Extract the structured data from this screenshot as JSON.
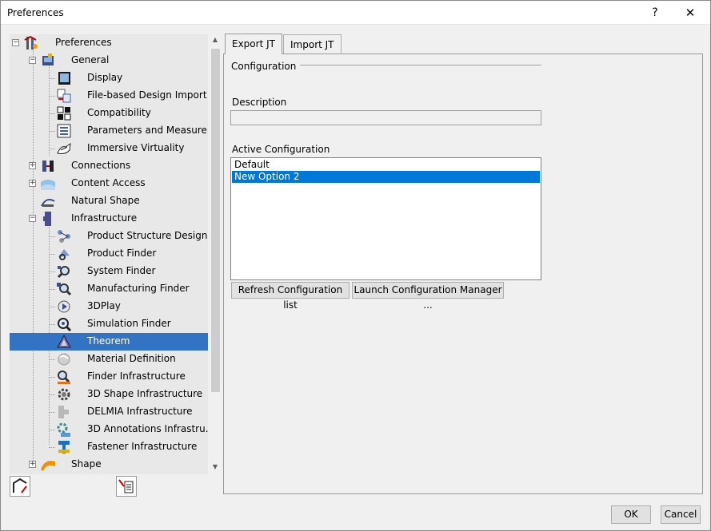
{
  "window": {
    "title": "Preferences",
    "help_label": "?",
    "close_label": "✕"
  },
  "tree": {
    "items": [
      {
        "label": "Preferences",
        "icon": "preferences-icon"
      },
      {
        "label": "General",
        "icon": "general-icon"
      },
      {
        "label": "Display",
        "icon": "display-icon"
      },
      {
        "label": "File-based Design Import",
        "icon": "file-import-icon"
      },
      {
        "label": "Compatibility",
        "icon": "compatibility-icon"
      },
      {
        "label": "Parameters and Measure",
        "icon": "parameters-icon"
      },
      {
        "label": "Immersive Virtuality",
        "icon": "immersive-icon"
      },
      {
        "label": "Connections",
        "icon": "connections-icon"
      },
      {
        "label": "Content Access",
        "icon": "content-access-icon"
      },
      {
        "label": "Natural Shape",
        "icon": "natural-shape-icon"
      },
      {
        "label": "Infrastructure",
        "icon": "infrastructure-icon"
      },
      {
        "label": "Product Structure Design",
        "icon": "product-structure-icon"
      },
      {
        "label": "Product Finder",
        "icon": "product-finder-icon"
      },
      {
        "label": "System Finder",
        "icon": "system-finder-icon"
      },
      {
        "label": "Manufacturing Finder",
        "icon": "manufacturing-finder-icon"
      },
      {
        "label": "3DPlay",
        "icon": "3dplay-icon"
      },
      {
        "label": "Simulation Finder",
        "icon": "simulation-finder-icon"
      },
      {
        "label": "Theorem",
        "icon": "theorem-icon",
        "selected": true
      },
      {
        "label": "Material Definition",
        "icon": "material-icon"
      },
      {
        "label": "Finder Infrastructure",
        "icon": "finder-infra-icon"
      },
      {
        "label": "3D Shape Infrastructure",
        "icon": "gear-icon"
      },
      {
        "label": "DELMIA Infrastructure",
        "icon": "delmia-icon"
      },
      {
        "label": "3D Annotations Infrastru...",
        "icon": "annotations-icon"
      },
      {
        "label": "Fastener Infrastructure",
        "icon": "fastener-icon"
      },
      {
        "label": "Shape",
        "icon": "shape-icon"
      }
    ]
  },
  "tabs": [
    {
      "label": "Export JT",
      "active": true
    },
    {
      "label": "Import JT",
      "active": false
    }
  ],
  "export_jt": {
    "configuration_label": "Configuration",
    "description_label": "Description",
    "description_value": "",
    "active_configuration_label": "Active Configuration",
    "configurations": [
      "Default",
      "New Option 2"
    ],
    "selected_configuration": "New Option 2",
    "refresh_button": "Refresh Configuration list",
    "launch_button": "Launch Configuration Manager ..."
  },
  "footer": {
    "ok_label": "OK",
    "cancel_label": "Cancel"
  },
  "colors": {
    "selection": "#3373c4",
    "list_selection": "#0078d7"
  }
}
